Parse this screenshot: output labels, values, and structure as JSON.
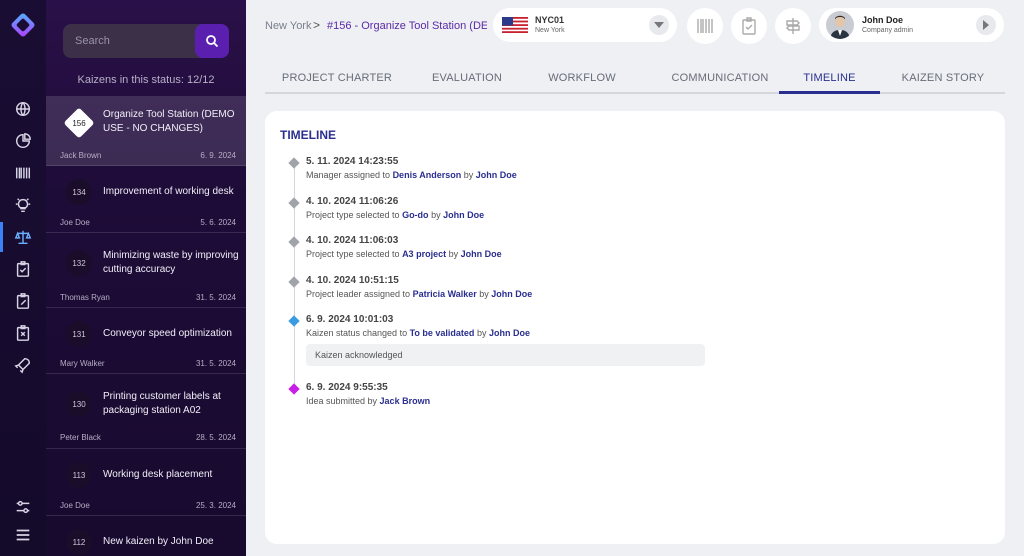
{
  "colors": {
    "accent": "#2a2f8f",
    "status_blue": "#3b9be0",
    "status_pink": "#c81ee8",
    "gray_dot": "#a0a3aa"
  },
  "rail": {
    "icons": [
      "globe-icon",
      "pie-chart-icon",
      "barcode-icon",
      "bulb-icon",
      "balance-icon",
      "clipboard-check-icon",
      "clipboard-edit-icon",
      "clipboard-x-icon",
      "rocket-icon",
      "sliders-icon",
      "menu-icon"
    ]
  },
  "list": {
    "search_placeholder": "Search",
    "count_label": "Kaizens in this status: 12/12",
    "items": [
      {
        "id": "156",
        "title": "Organize Tool Station (DEMO USE - NO CHANGES)",
        "user": "Jack Brown",
        "date": "6. 9. 2024"
      },
      {
        "id": "134",
        "title": "Improvement of working desk",
        "user": "Joe Doe",
        "date": "5. 6. 2024"
      },
      {
        "id": "132",
        "title": "Minimizing waste by improving cutting accuracy",
        "user": "Thomas Ryan",
        "date": "31. 5. 2024"
      },
      {
        "id": "131",
        "title": "Conveyor speed optimization",
        "user": "Mary Walker",
        "date": "31. 5. 2024"
      },
      {
        "id": "130",
        "title": "Printing customer labels at packaging station A02",
        "user": "Peter Black",
        "date": "28. 5. 2024"
      },
      {
        "id": "113",
        "title": "Working desk placement",
        "user": "Joe Doe",
        "date": "25. 3. 2024"
      },
      {
        "id": "112",
        "title": "New kaizen by John Doe",
        "user": "",
        "date": ""
      }
    ]
  },
  "breadcrumb": {
    "city": "New York",
    "sep": ">",
    "title": "#156 - Organize Tool Station (DE..."
  },
  "site": {
    "code": "NYC01",
    "city": "New York"
  },
  "user": {
    "name": "John Doe",
    "role": "Company admin"
  },
  "tabs": [
    "PROJECT CHARTER",
    "EVALUATION",
    "WORKFLOW",
    "COMMUNICATION",
    "TIMELINE",
    "KAIZEN STORY"
  ],
  "timeline": {
    "title": "TIMELINE",
    "events": [
      {
        "date": "5. 11. 2024 14:23:55",
        "pre": "Manager assigned to ",
        "target": "Denis Anderson",
        "by": " by ",
        "actor": "John Doe",
        "type": "gray"
      },
      {
        "date": "4. 10. 2024 11:06:26",
        "pre": "Project type selected to ",
        "target": "Go-do",
        "by": " by ",
        "actor": "John Doe",
        "type": "gray"
      },
      {
        "date": "4. 10. 2024 11:06:03",
        "pre": "Project type selected to ",
        "target": "A3 project",
        "by": " by ",
        "actor": "John Doe",
        "type": "gray"
      },
      {
        "date": "4. 10. 2024 10:51:15",
        "pre": "Project leader assigned to ",
        "target": "Patricia Walker",
        "by": " by ",
        "actor": "John Doe",
        "type": "gray"
      },
      {
        "date": "6. 9. 2024 10:01:03",
        "pre": "Kaizen status changed to ",
        "target": "To be validated",
        "by": " by ",
        "actor": "John Doe",
        "type": "blue",
        "note": "Kaizen acknowledged"
      },
      {
        "date": "6. 9. 2024 9:55:35",
        "pre": "Idea submitted by ",
        "target": "Jack Brown",
        "by": "",
        "actor": "",
        "type": "pink"
      }
    ]
  }
}
